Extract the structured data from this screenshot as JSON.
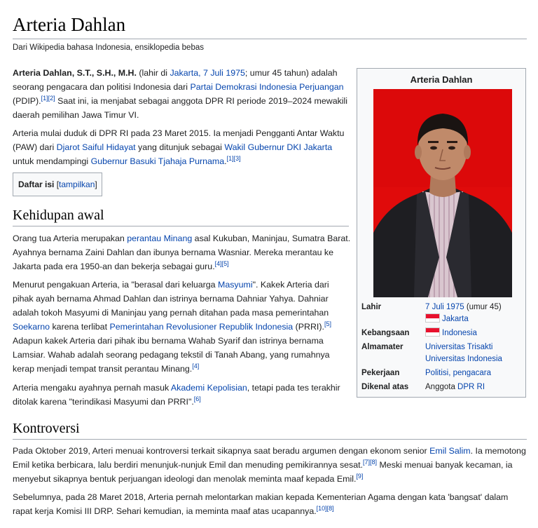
{
  "title": "Arteria Dahlan",
  "tagline": "Dari Wikipedia bahasa Indonesia, ensiklopedia bebas",
  "lead": {
    "p1": {
      "name_bold": "Arteria Dahlan, S.T., S.H., M.H.",
      "t1": " (lahir di ",
      "link_birth": "Jakarta, 7 Juli 1975",
      "t2": "; umur 45 tahun) adalah seorang pengacara dan politisi Indonesia dari ",
      "link_party": "Partai Demokrasi Indonesia Perjuangan",
      "t3": " (PDIP).",
      "ref1": "[1][2]",
      "t4": " Saat ini, ia menjabat sebagai anggota DPR RI periode 2019–2024 mewakili daerah pemilihan Jawa Timur VI."
    },
    "p2": {
      "t1": "Arteria mulai duduk di DPR RI pada 23 Maret 2015. Ia menjadi Pengganti Antar Waktu (PAW) dari ",
      "link1": "Djarot Saiful Hidayat",
      "t2": " yang ditunjuk sebagai ",
      "link2": "Wakil Gubernur DKI Jakarta",
      "t3": " untuk mendampingi ",
      "link3": "Gubernur Basuki Tjahaja Purnama",
      "t4": ".",
      "ref": "[1][3]"
    }
  },
  "toc": {
    "title": "Daftar isi",
    "open": "[",
    "toggle": "tampilkan",
    "close": "]"
  },
  "section1": {
    "heading": "Kehidupan awal",
    "p1": {
      "t1": "Orang tua Arteria merupakan ",
      "link1": "perantau Minang",
      "t2": " asal Kukuban, Maninjau, Sumatra Barat. Ayahnya bernama Zaini Dahlan dan ibunya bernama Wasniar. Mereka merantau ke Jakarta pada era 1950-an dan bekerja sebagai guru.",
      "ref": "[4][5]"
    },
    "p2": {
      "t1": "Menurut pengakuan Arteria, ia \"berasal dari keluarga ",
      "link1": "Masyumi",
      "t2": "\". Kakek Arteria dari pihak ayah bernama Ahmad Dahlan dan istrinya bernama Dahniar Yahya. Dahniar adalah tokoh Masyumi di Maninjau yang pernah ditahan pada masa pemerintahan ",
      "link2": "Soekarno",
      "t3": " karena terlibat ",
      "link3": "Pemerintahan Revolusioner Republik Indonesia",
      "t4": " (PRRI).",
      "ref1": "[5]",
      "t5": " Adapun kakek Arteria dari pihak ibu bernama Wahab Syarif dan istrinya bernama Lamsiar. Wahab adalah seorang pedagang tekstil di Tanah Abang, yang rumahnya kerap menjadi tempat transit perantau Minang.",
      "ref2": "[4]"
    },
    "p3": {
      "t1": "Arteria mengaku ayahnya pernah masuk ",
      "link1": "Akademi Kepolisian",
      "t2": ", tetapi pada tes terakhir ditolak karena \"terindikasi Masyumi dan PRRI\".",
      "ref": "[6]"
    }
  },
  "section2": {
    "heading": "Kontroversi",
    "p1": {
      "t1": "Pada Oktober 2019, Arteri menuai kontroversi terkait sikapnya saat beradu argumen dengan ekonom senior ",
      "link1": "Emil Salim",
      "t2": ". Ia memotong Emil ketika berbicara, lalu berdiri menunjuk-nunjuk Emil dan menuding pemikirannya sesat.",
      "ref1": "[7][8]",
      "t3": " Meski menuai banyak kecaman, ia menyebut sikapnya bentuk perjuangan ideologi dan menolak meminta maaf kepada Emil.",
      "ref2": "[9]"
    },
    "p2": {
      "t1": "Sebelumnya, pada 28 Maret 2018, Arteria pernah melontarkan makian kepada Kementerian Agama dengan kata 'bangsat' dalam rapat kerja Komisi III DRP. Sehari kemudian, ia meminta maaf atas ucapannya.",
      "ref": "[10][8]"
    }
  },
  "infobox": {
    "title": "Arteria Dahlan",
    "rows": {
      "lahir": {
        "label": "Lahir",
        "date": "7 Juli 1975",
        "age": " (umur 45)",
        "place": "Jakarta"
      },
      "kebangsaan": {
        "label": "Kebangsaan",
        "value": "Indonesia"
      },
      "almamater": {
        "label": "Almamater",
        "v1": "Universitas Trisakti",
        "v2": "Universitas Indonesia"
      },
      "pekerjaan": {
        "label": "Pekerjaan",
        "value": "Politisi, pengacara"
      },
      "dikenal": {
        "label": "Dikenal atas",
        "t1": "Anggota ",
        "link": "DPR RI"
      }
    }
  },
  "colors": {
    "link": "#0645ad",
    "text": "#202122",
    "border": "#a2a9b1",
    "infobox_bg": "#f8f9fa",
    "photo_bg": "#e00b0b"
  }
}
